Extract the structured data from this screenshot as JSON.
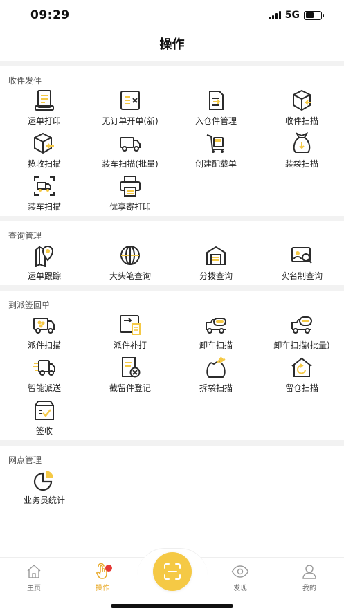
{
  "status_bar": {
    "time": "09:29",
    "network": "5G"
  },
  "header": {
    "title": "操作"
  },
  "sections": [
    {
      "title": "收件发件",
      "items": [
        {
          "name": "waybill-print",
          "label": "运单打印",
          "icon": "printer-doc-icon"
        },
        {
          "name": "no-order-waybill-new",
          "label": "无订单开单(新)",
          "icon": "list-cross-icon"
        },
        {
          "name": "warehouse-in",
          "label": "入仓件管理",
          "icon": "doc-arrow-icon"
        },
        {
          "name": "receive-scan",
          "label": "收件扫描",
          "icon": "box-arrow-icon"
        },
        {
          "name": "pickup-scan",
          "label": "揽收扫描",
          "icon": "box-left-arrow-icon"
        },
        {
          "name": "load-scan-batch",
          "label": "装车扫描(批量)",
          "icon": "truck-icon"
        },
        {
          "name": "create-manifest",
          "label": "创建配载单",
          "icon": "cart-icon"
        },
        {
          "name": "bagging-scan",
          "label": "装袋扫描",
          "icon": "bag-icon"
        },
        {
          "name": "load-scan",
          "label": "装车扫描",
          "icon": "truck-frame-icon"
        },
        {
          "name": "youxiangji-print",
          "label": "优享寄打印",
          "icon": "printer-icon"
        }
      ]
    },
    {
      "title": "查询管理",
      "items": [
        {
          "name": "waybill-track",
          "label": "运单跟踪",
          "icon": "location-pin-icon"
        },
        {
          "name": "big-pen-query",
          "label": "大头笔查询",
          "icon": "globe-icon"
        },
        {
          "name": "sort-query",
          "label": "分拨查询",
          "icon": "warehouse-icon"
        },
        {
          "name": "realname-query",
          "label": "实名制查询",
          "icon": "id-card-search-icon"
        }
      ]
    },
    {
      "title": "到派签回单",
      "items": [
        {
          "name": "dispatch-scan",
          "label": "派件扫描",
          "icon": "delivery-truck-icon"
        },
        {
          "name": "dispatch-supplement",
          "label": "派件补打",
          "icon": "package-print-icon"
        },
        {
          "name": "unload-scan",
          "label": "卸车扫描",
          "icon": "tank-truck-icon"
        },
        {
          "name": "unload-scan-batch",
          "label": "卸车扫描(批量)",
          "icon": "tank-truck-batch-icon"
        },
        {
          "name": "smart-dispatch",
          "label": "智能派送",
          "icon": "fast-truck-icon"
        },
        {
          "name": "detained-register",
          "label": "截留件登记",
          "icon": "doc-cancel-icon"
        },
        {
          "name": "unbag-scan",
          "label": "拆袋扫描",
          "icon": "open-bag-icon"
        },
        {
          "name": "retain-scan",
          "label": "留仓扫描",
          "icon": "house-refresh-icon"
        },
        {
          "name": "sign-receipt",
          "label": "签收",
          "icon": "box-check-icon"
        }
      ]
    },
    {
      "title": "网点管理",
      "items": [
        {
          "name": "staff-stats",
          "label": "业务员统计",
          "icon": "pie-chart-icon"
        }
      ]
    }
  ],
  "tabbar": {
    "tabs": [
      {
        "label": "主页",
        "icon": "home-icon"
      },
      {
        "label": "操作",
        "icon": "hand-tap-icon"
      },
      {
        "label": "发现",
        "icon": "eye-icon"
      },
      {
        "label": "我的",
        "icon": "user-icon"
      }
    ],
    "center_icon": "scan-icon"
  },
  "colors": {
    "accent": "#F5C945",
    "icon_dark": "#2B2B2B",
    "active_tab": "#E8A825",
    "badge": "#E53935"
  }
}
